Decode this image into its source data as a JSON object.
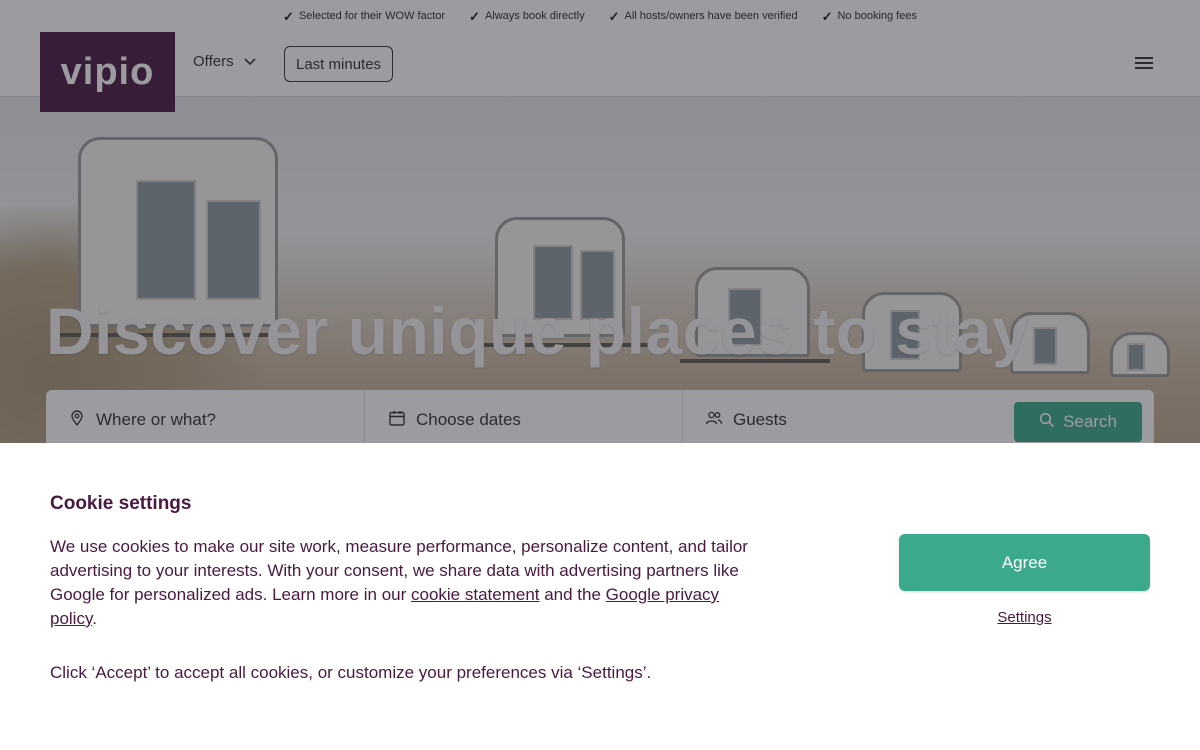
{
  "usp_bar": {
    "items": [
      "Selected for their WOW factor",
      "Always book directly",
      "All hosts/owners have been verified",
      "No booking fees"
    ]
  },
  "header": {
    "logo": "vipio",
    "nav_offers": "Offers",
    "nav_last_minutes": "Last minutes"
  },
  "hero": {
    "title": "Discover unique places to stay"
  },
  "search": {
    "where": "Where or what?",
    "dates": "Choose dates",
    "guests": "Guests",
    "button": "Search"
  },
  "cookie": {
    "title": "Cookie settings",
    "text_before": "We use cookies to make our site work, measure performance, personalize content, and tailor advertising to your interests. With your consent, we share data with advertising partners like Google for personalized ads. Learn more in our ",
    "link_cookie_statement": "cookie statement",
    "text_middle": " and the ",
    "link_google_privacy": "Google privacy policy",
    "text_after": ".",
    "text_2": "Click ‘Accept’ to accept all cookies, or customize your preferences via ‘Settings’.",
    "agree_button": "Agree",
    "settings_link": "Settings"
  },
  "colors": {
    "brand_purple": "#4a1942",
    "accent_green": "#3aa98c"
  }
}
